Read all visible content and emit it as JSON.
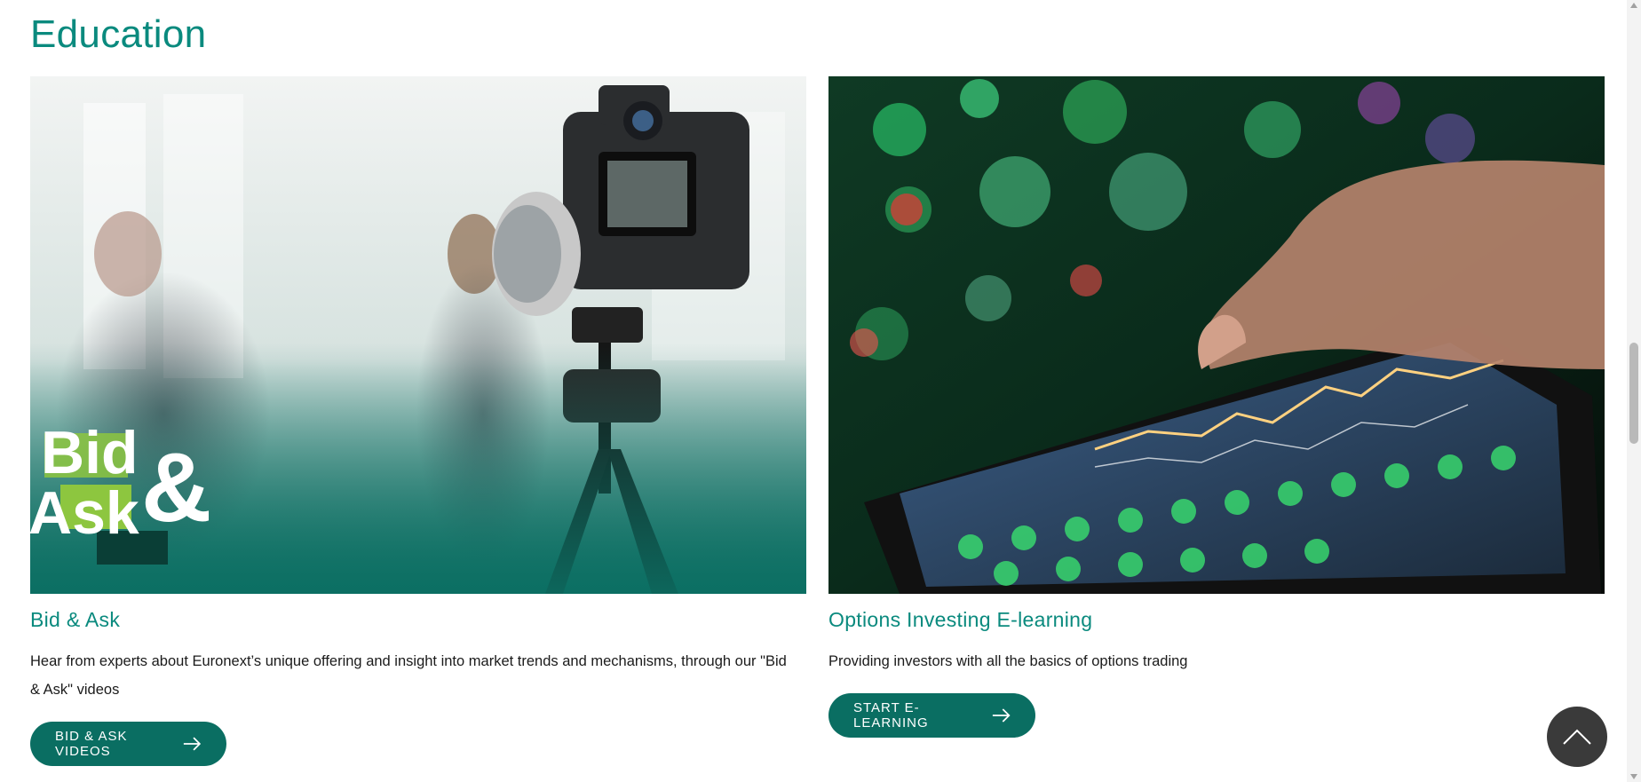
{
  "section": {
    "title": "Education"
  },
  "cards": [
    {
      "title": "Bid & Ask",
      "description": "Hear from experts about Euronext’s unique offering and insight into market trends and mechanisms, through our \"Bid & Ask\" videos",
      "button_label": "BID & ASK VIDEOS",
      "image": {
        "icon": "camera-interview-photo",
        "logo_line1": "Bid",
        "logo_line2": "Ask",
        "logo_amp": "&"
      }
    },
    {
      "title": "Options Investing E-learning",
      "description": "Providing investors with all the basics of options trading",
      "button_label": "START E-LEARNING",
      "image": {
        "icon": "tablet-trading-chart-photo"
      }
    }
  ],
  "scroll_top": {
    "icon": "chevron-up-icon"
  },
  "colors": {
    "accent": "#0a8a7e",
    "button": "#0a6e62",
    "dark": "#3a3a3a"
  }
}
